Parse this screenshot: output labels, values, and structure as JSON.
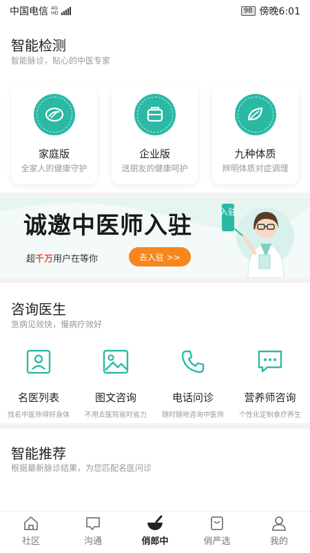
{
  "status_bar": {
    "carrier": "中国电信",
    "net_top": "4G",
    "net_bottom": "HD",
    "battery": "98",
    "time": "傍晚6:01"
  },
  "smart_detect": {
    "title": "智能检测",
    "subtitle": "智能脉诊，贴心的中医专家",
    "cards": [
      {
        "name": "家庭版",
        "desc": "全家人的健康守护",
        "icon": "family-icon"
      },
      {
        "name": "企业版",
        "desc": "送朋友的健康呵护",
        "icon": "enterprise-icon"
      },
      {
        "name": "九种体质",
        "desc": "辨明体质对症调理",
        "icon": "leaf-icon"
      }
    ]
  },
  "banner": {
    "title": "诚邀中医师入驻",
    "sub_prefix": "超",
    "sub_highlight": "千万",
    "sub_suffix": "用户在等你",
    "button": "去入驻 >>",
    "badge": "入驻"
  },
  "consult": {
    "title": "咨询医生",
    "subtitle": "急病见效快，慢病疗效好",
    "items": [
      {
        "label": "名医列表",
        "desc": "找名中医师得好身体",
        "icon": "doctor-list-icon"
      },
      {
        "label": "图文咨询",
        "desc": "不用去医院省时省力",
        "icon": "image-icon"
      },
      {
        "label": "电话问诊",
        "desc": "随时随地咨询中医师",
        "icon": "phone-icon"
      },
      {
        "label": "营养师咨询",
        "desc": "个性化定制食疗养生",
        "icon": "chat-icon"
      }
    ]
  },
  "recommend": {
    "title": "智能推荐",
    "subtitle": "根据最新脉诊结果，为您匹配名医问诊"
  },
  "tabbar": {
    "tabs": [
      {
        "label": "社区",
        "icon": "home-icon"
      },
      {
        "label": "沟通",
        "icon": "message-icon"
      },
      {
        "label": "俏郎中",
        "icon": "mortar-icon"
      },
      {
        "label": "俏严选",
        "icon": "shop-icon"
      },
      {
        "label": "我的",
        "icon": "user-icon"
      }
    ],
    "active": "俏郎中"
  },
  "colors": {
    "accent": "#2bb9a5",
    "orange": "#f7861d",
    "highlight": "#e54b3c"
  }
}
